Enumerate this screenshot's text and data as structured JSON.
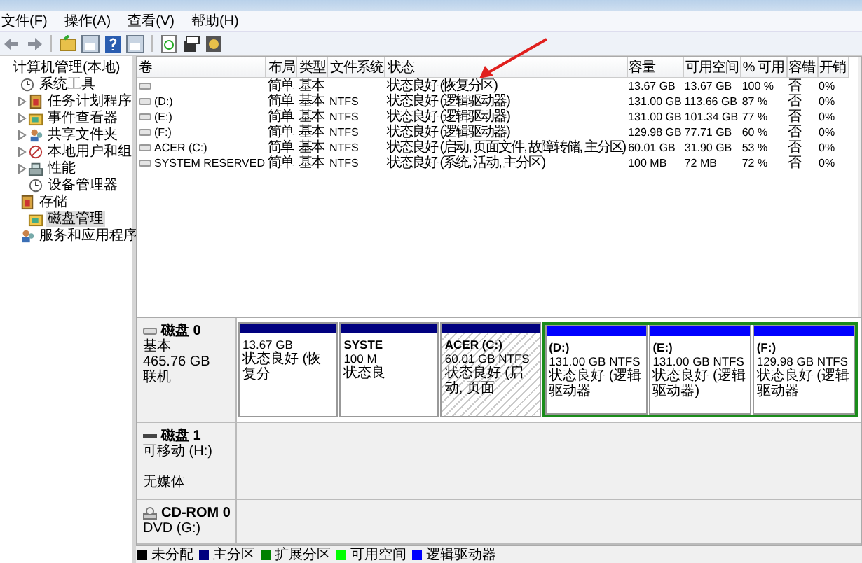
{
  "menu": [
    "文件(F)",
    "操作(A)",
    "查看(V)",
    "帮助(H)"
  ],
  "tree": [
    {
      "label": "计算机管理(本地)",
      "selected": false,
      "collapsed": false,
      "children": [
        {
          "label": "系统工具",
          "selected": false,
          "collapsed": false,
          "children": [
            {
              "label": "任务计划程序",
              "selected": false,
              "collapsed": true
            },
            {
              "label": "事件查看器",
              "selected": false,
              "collapsed": true
            },
            {
              "label": "共享文件夹",
              "selected": false,
              "collapsed": true
            },
            {
              "label": "本地用户和组",
              "selected": false,
              "collapsed": true
            },
            {
              "label": "性能",
              "selected": false,
              "collapsed": true
            },
            {
              "label": "设备管理器",
              "selected": false,
              "collapsed": false
            }
          ]
        },
        {
          "label": "存储",
          "selected": false,
          "collapsed": false,
          "children": [
            {
              "label": "磁盘管理",
              "selected": true,
              "collapsed": false
            }
          ]
        },
        {
          "label": "服务和应用程序",
          "selected": false,
          "collapsed": false
        }
      ]
    }
  ],
  "volumes": {
    "columns": [
      "卷",
      "布局",
      "类型",
      "文件系统",
      "状态",
      "容量",
      "可用空间",
      "% 可用",
      "容错",
      "开销"
    ],
    "rows": [
      {
        "layout": "简单",
        "type": "基本",
        "status": "状态良好 (恢复分区)",
        "capacity": "13.67 GB",
        "free": "13.67 GB",
        "percent_free": "100 %",
        "fault_tolerance": "否",
        "overhead": "0%"
      },
      {
        "volume": "(D:)",
        "layout": "简单",
        "type": "基本",
        "filesystem": "NTFS",
        "status": "状态良好 (逻辑驱动器)",
        "capacity": "131.00 GB",
        "free": "113.66 GB",
        "percent_free": "87 %",
        "fault_tolerance": "否",
        "overhead": "0%"
      },
      {
        "volume": "(E:)",
        "layout": "简单",
        "type": "基本",
        "filesystem": "NTFS",
        "status": "状态良好 (逻辑驱动器)",
        "capacity": "131.00 GB",
        "free": "101.34 GB",
        "percent_free": "77 %",
        "fault_tolerance": "否",
        "overhead": "0%"
      },
      {
        "volume": "(F:)",
        "layout": "简单",
        "type": "基本",
        "filesystem": "NTFS",
        "status": "状态良好 (逻辑驱动器)",
        "capacity": "129.98 GB",
        "free": "77.71 GB",
        "percent_free": "60 %",
        "fault_tolerance": "否",
        "overhead": "0%"
      },
      {
        "volume": "ACER (C:)",
        "layout": "简单",
        "type": "基本",
        "filesystem": "NTFS",
        "status": "状态良好 (启动, 页面文件, 故障转储, 主分区)",
        "capacity": "60.01 GB",
        "free": "31.90 GB",
        "percent_free": "53 %",
        "fault_tolerance": "否",
        "overhead": "0%"
      },
      {
        "volume": "SYSTEM RESERVED",
        "layout": "简单",
        "type": "基本",
        "filesystem": "NTFS",
        "status": "状态良好 (系统, 活动, 主分区)",
        "capacity": "100 MB",
        "free": "72 MB",
        "percent_free": "72 %",
        "fault_tolerance": "否",
        "overhead": "0%"
      }
    ]
  },
  "disks": [
    {
      "name": "磁盘 0",
      "kind": "basic",
      "type": "基本",
      "size": "465.76 GB",
      "status": "联机",
      "partitions": [
        {
          "kind": "primary",
          "size": "13.67 GB",
          "status": "状态良好 (恢复分",
          "selected": false
        },
        {
          "kind": "primary",
          "name": "SYSTE",
          "size": "100 M",
          "status": "状态良",
          "selected": false
        },
        {
          "kind": "primary",
          "name": "ACER  (C:)",
          "size": "60.01 GB NTFS",
          "status": "状态良好 (启动, 页面",
          "selected": true
        },
        {
          "kind": "extended",
          "selected": false,
          "children": [
            {
              "kind": "logical",
              "name": "(D:)",
              "size": "131.00 GB NTFS",
              "status": "状态良好 (逻辑驱动器",
              "selected": false
            },
            {
              "kind": "logical",
              "name": "(E:)",
              "size": "131.00 GB NTFS",
              "status": "状态良好 (逻辑驱动器)",
              "selected": false
            },
            {
              "kind": "logical",
              "name": "(F:)",
              "size": "129.98 GB NTFS",
              "status": "状态良好 (逻辑驱动器",
              "selected": false
            }
          ]
        }
      ]
    },
    {
      "name": "磁盘 1",
      "kind": "removable",
      "type": "可移动 (H:)",
      "status": "无媒体"
    },
    {
      "name": "CD-ROM 0",
      "kind": "cdrom",
      "type": "DVD (G:)"
    }
  ],
  "legend": [
    {
      "label": "未分配",
      "color": "#000000"
    },
    {
      "label": "主分区",
      "color": "#00007f"
    },
    {
      "label": "扩展分区",
      "color": "#008000"
    },
    {
      "label": "可用空间",
      "color": "#00ff00"
    },
    {
      "label": "逻辑驱动器",
      "color": "#0000ff"
    }
  ]
}
